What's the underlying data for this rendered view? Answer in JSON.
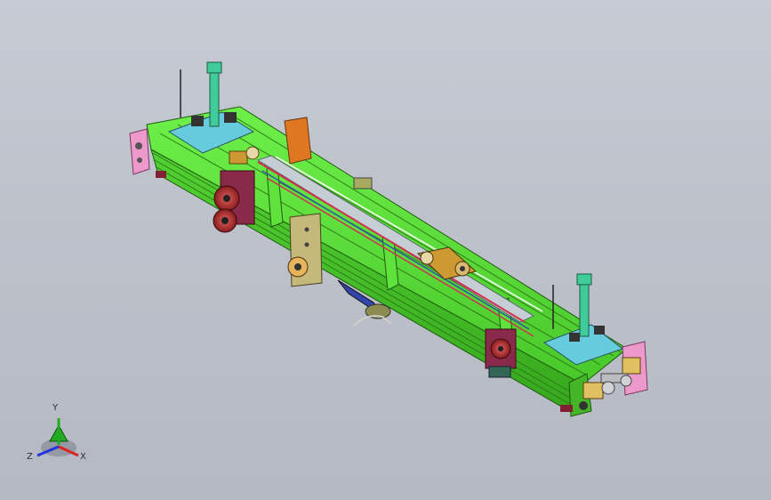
{
  "viewport": {
    "background_top": "#c7cbd4",
    "background_bottom": "#b4b9c3"
  },
  "model": {
    "frame_color": "#55dd33",
    "plate_color": "#66ccdd",
    "bracket_color": "#ee99cc",
    "motor_color": "#bb3333",
    "bronze_color": "#cc9933",
    "orange_color": "#dd7722",
    "steel_color": "#b9bcc0"
  },
  "triad": {
    "x_label": "X",
    "y_label": "Y",
    "z_label": "Z",
    "x_color": "#dd2222",
    "y_color": "#22aa22",
    "z_color": "#2233dd"
  }
}
